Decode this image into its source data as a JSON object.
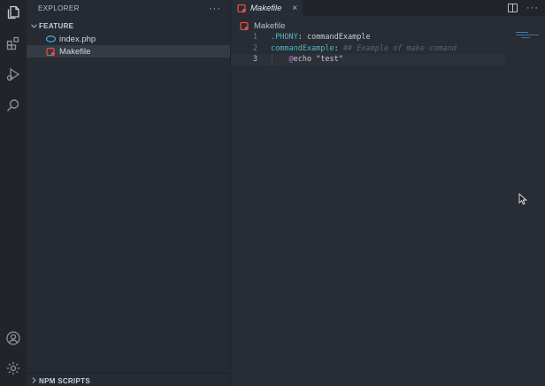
{
  "activity_bar": {
    "icons": [
      "explorer-icon",
      "extensions-icon",
      "run-debug-icon",
      "search-icon",
      "account-icon",
      "settings-gear-icon"
    ]
  },
  "sidebar": {
    "title": "EXPLORER",
    "more": "···",
    "folder": "FEATURE",
    "files": [
      {
        "name": "index.php",
        "icon": "php-file-icon"
      },
      {
        "name": "Makefile",
        "icon": "makefile-icon",
        "selected": true
      }
    ],
    "npm_section": "NPM SCRIPTS"
  },
  "editor": {
    "tab": {
      "label": "Makefile",
      "close": "×"
    },
    "more": "···",
    "breadcrumb": "Makefile",
    "lines": [
      {
        "num": "1",
        "parts": [
          {
            "t": ".PHONY",
            "c": "target"
          },
          {
            "t": ": commandExample",
            "c": "plain"
          }
        ]
      },
      {
        "num": "2",
        "parts": [
          {
            "t": "commandExample",
            "c": "target"
          },
          {
            "t": ": ",
            "c": "plain"
          },
          {
            "t": "## Example of make comand",
            "c": "comment"
          }
        ]
      },
      {
        "num": "3",
        "parts": [
          {
            "t": "    ",
            "c": "plain"
          },
          {
            "t": "@",
            "c": "at"
          },
          {
            "t": "echo \"test\"",
            "c": "str"
          }
        ]
      }
    ]
  },
  "colors": {
    "makefile_accent": "#e0504a",
    "php_accent": "#4a9ed8"
  }
}
